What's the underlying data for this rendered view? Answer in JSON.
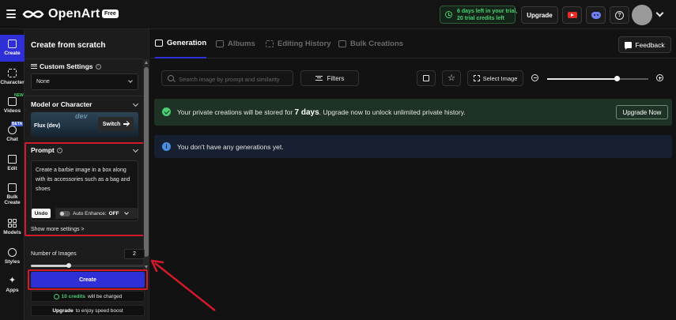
{
  "topbar": {
    "brand": "OpenArt",
    "plan_badge": "Free",
    "trial_line1": "6 days left in your trial,",
    "trial_line2": "20 trial credits left",
    "upgrade": "Upgrade",
    "help_glyph": "?"
  },
  "leftnav": {
    "items": [
      {
        "label": "Create",
        "icon": "pencil-square-icon"
      },
      {
        "label": "Character",
        "icon": "character-icon"
      },
      {
        "label": "Videos",
        "icon": "video-icon",
        "badge": "NEW"
      },
      {
        "label": "Chat",
        "icon": "chat-icon",
        "badge": "BETA"
      },
      {
        "label": "Edit",
        "icon": "edit-icon"
      },
      {
        "label": "Bulk Create",
        "icon": "bulk-create-icon"
      },
      {
        "label": "Models",
        "icon": "models-grid-icon"
      },
      {
        "label": "Styles",
        "icon": "palette-icon"
      },
      {
        "label": "Apps",
        "icon": "sparkle-icon"
      }
    ]
  },
  "panel": {
    "title": "Create from scratch",
    "custom_settings": {
      "title": "Custom Settings",
      "value": "None"
    },
    "model": {
      "title": "Model or Character",
      "name": "Flux (dev)",
      "watermark": "dev",
      "switch": "Switch"
    },
    "prompt": {
      "title": "Prompt",
      "text": "Create a barbie image in a box along with its accessories such as a bag and shoes",
      "undo": "Undo",
      "auto_enhance_label": "Auto Enhance:",
      "auto_enhance_value": "OFF",
      "show_more": "Show more settings >"
    },
    "num_images": {
      "label": "Number of Images",
      "value": "2",
      "slider_fraction": 0.33
    },
    "create": "Create",
    "credits": {
      "amount": "10 credits",
      "suffix": "will be charged"
    },
    "speed": {
      "bold": "Upgrade",
      "rest": "to enjoy speed boost"
    }
  },
  "main": {
    "tabs": [
      {
        "label": "Generation",
        "active": true
      },
      {
        "label": "Albums",
        "active": false
      },
      {
        "label": "Editing History",
        "active": false
      },
      {
        "label": "Bulk Creations",
        "active": false
      }
    ],
    "feedback": "Feedback",
    "search_placeholder": "Search image by prompt and similarity",
    "filters": "Filters",
    "select_image": "Select Image",
    "zoom_fraction": 0.69,
    "banner_private": {
      "pre": "Your private creations will be stored for",
      "bold": "7 days",
      "post": ". Upgrade now to unlock unlimited private history.",
      "button": "Upgrade Now"
    },
    "banner_info": {
      "text": "You don't have any generations yet.",
      "icon_glyph": "i"
    }
  },
  "colors": {
    "accent": "#2f2fd8",
    "highlight": "#d11a2a",
    "success": "#4ad073",
    "info": "#4a90e2"
  }
}
